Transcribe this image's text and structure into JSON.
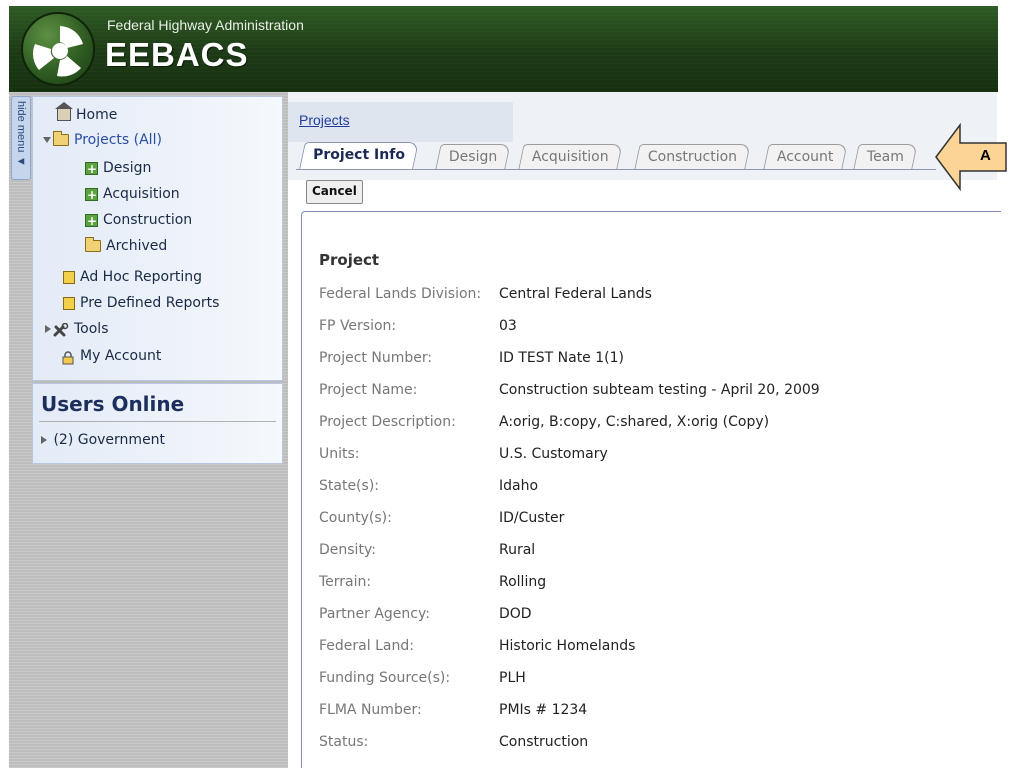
{
  "header": {
    "agency": "Federal Highway Administration",
    "app_name": "EEBACS"
  },
  "sidebar": {
    "hide_menu_label": "hide menu ◄",
    "items": [
      {
        "label": "Home",
        "icon": "home-icon"
      },
      {
        "label": "Projects (All)",
        "icon": "folder-icon"
      },
      {
        "label": "Design",
        "icon": "add-icon"
      },
      {
        "label": "Acquisition",
        "icon": "add-icon"
      },
      {
        "label": "Construction",
        "icon": "add-icon"
      },
      {
        "label": "Archived",
        "icon": "folder-icon"
      },
      {
        "label": "Ad Hoc Reporting",
        "icon": "report-icon"
      },
      {
        "label": "Pre Defined Reports",
        "icon": "report-icon"
      },
      {
        "label": "Tools",
        "icon": "tools-icon"
      },
      {
        "label": "My Account",
        "icon": "lock-icon"
      }
    ]
  },
  "users_online": {
    "title": "Users Online",
    "item": "(2) Government"
  },
  "breadcrumb": "Projects",
  "tabs": [
    {
      "label": "Project Info",
      "active": true
    },
    {
      "label": "Design",
      "active": false
    },
    {
      "label": "Acquisition",
      "active": false
    },
    {
      "label": "Construction",
      "active": false
    },
    {
      "label": "Account",
      "active": false
    },
    {
      "label": "Team",
      "active": false
    }
  ],
  "callout_label": "A",
  "cancel_label": "Cancel",
  "project": {
    "section_title": "Project",
    "fields": [
      {
        "label": "Federal Lands Division:",
        "value": "Central Federal Lands"
      },
      {
        "label": "FP Version:",
        "value": "03"
      },
      {
        "label": "Project Number:",
        "value": "ID TEST Nate 1(1)"
      },
      {
        "label": "Project Name:",
        "value": "Construction subteam testing - April 20, 2009"
      },
      {
        "label": "Project Description:",
        "value": "A:orig, B:copy, C:shared, X:orig (Copy)"
      },
      {
        "label": "Units:",
        "value": "U.S. Customary"
      },
      {
        "label": "State(s):",
        "value": "Idaho"
      },
      {
        "label": "County(s):",
        "value": "ID/Custer"
      },
      {
        "label": "Density:",
        "value": "Rural"
      },
      {
        "label": "Terrain:",
        "value": "Rolling"
      },
      {
        "label": "Partner Agency:",
        "value": "DOD"
      },
      {
        "label": "Federal Land:",
        "value": "Historic Homelands"
      },
      {
        "label": "Funding Source(s):",
        "value": "PLH"
      },
      {
        "label": "FLMA Number:",
        "value": "PMIs # 1234"
      },
      {
        "label": "Status:",
        "value": "Construction"
      }
    ]
  },
  "colors": {
    "header_green": "#1d3a16",
    "sidebar_blue": "#e3ebf7",
    "link_blue": "#1f3d9e",
    "callout_fill": "#fcd596"
  }
}
